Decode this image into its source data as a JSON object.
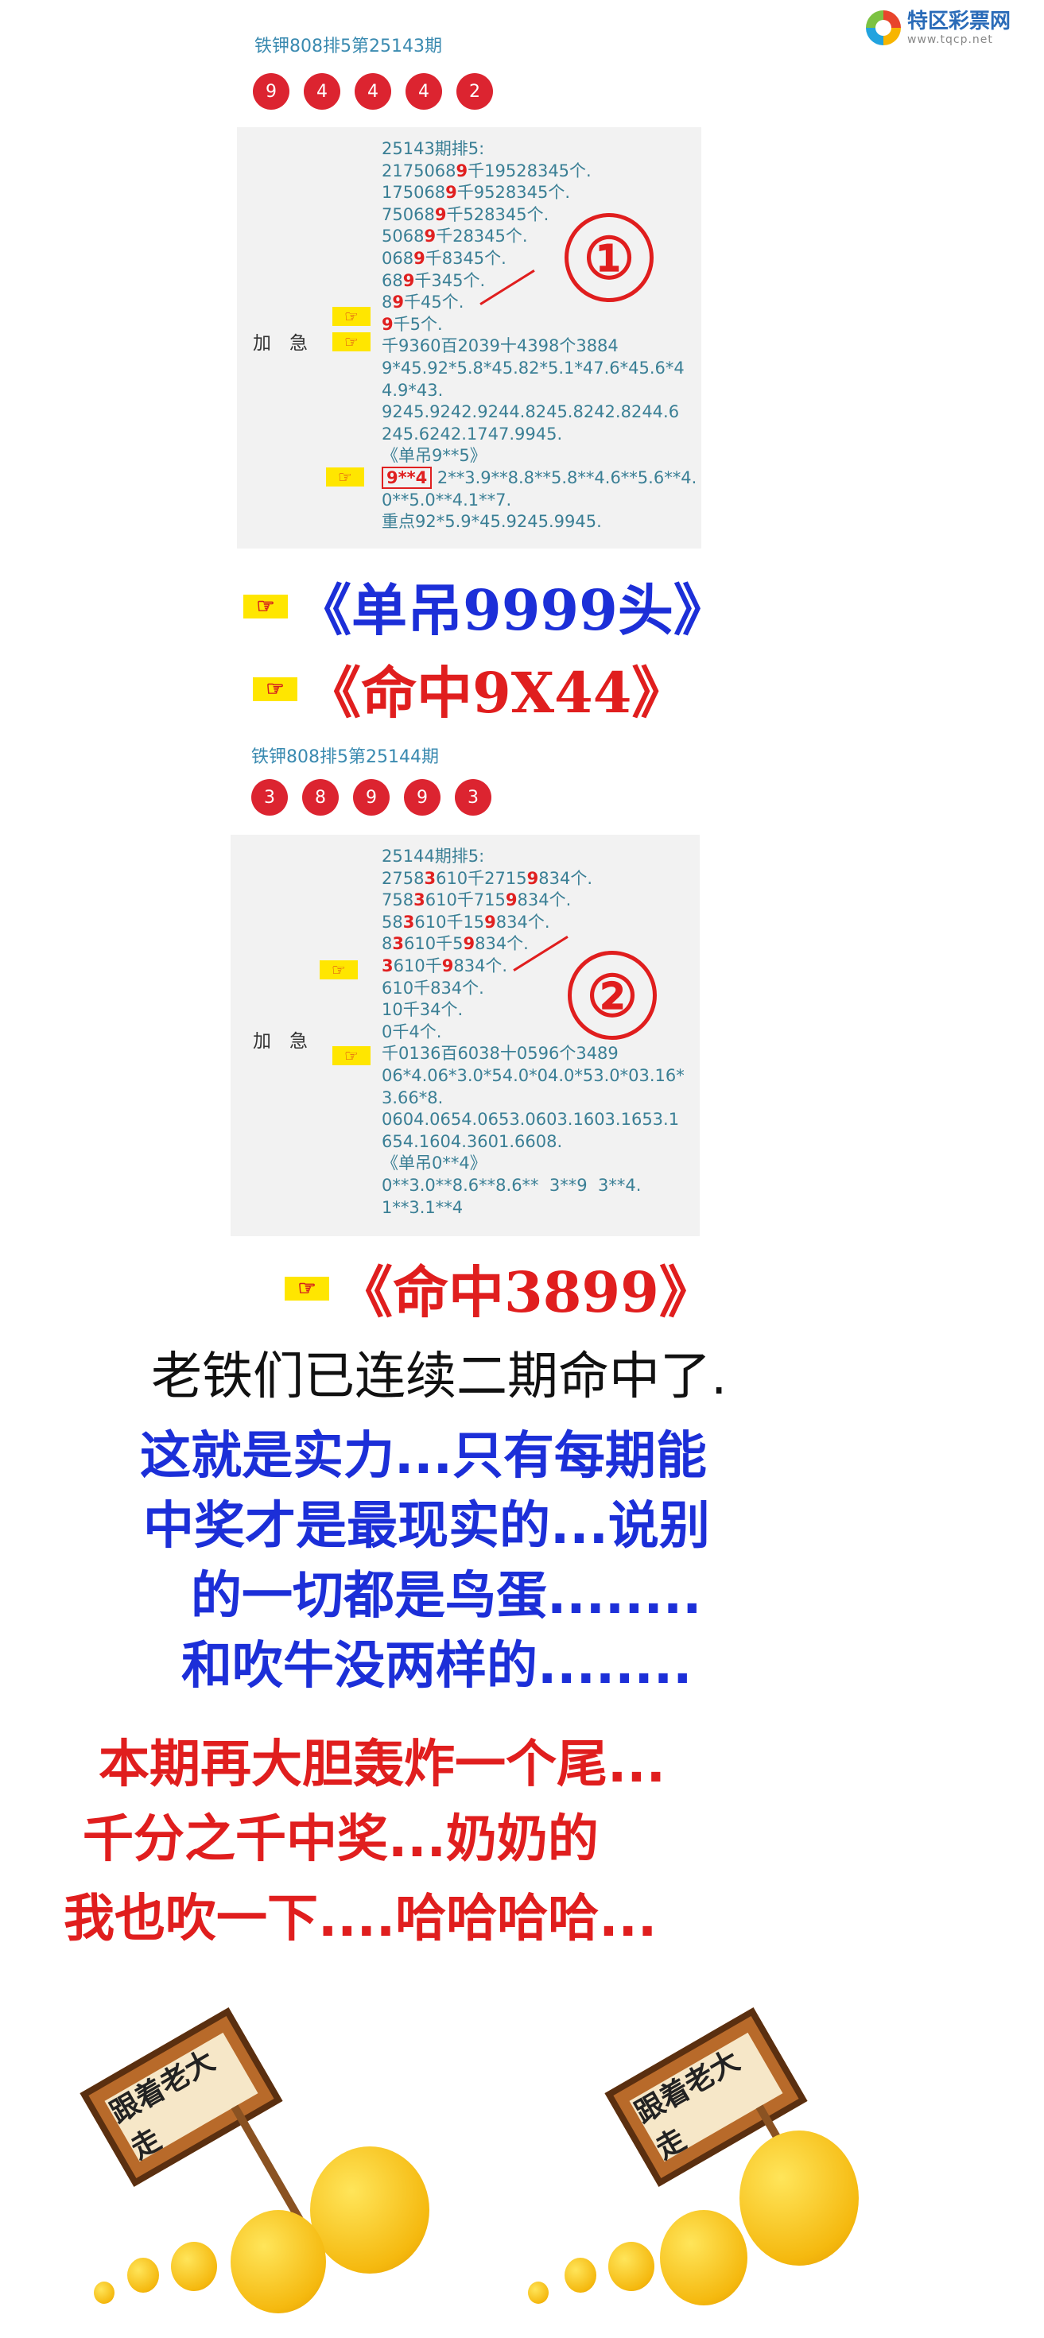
{
  "site": {
    "name": "特区彩票网",
    "url": "www.tqcp.net"
  },
  "section1": {
    "issue_title": "铁钾808排5第25143期",
    "balls": [
      "9",
      "4",
      "4",
      "4",
      "2"
    ],
    "badge": "①",
    "side_label": "加　急",
    "hand_icon": "pointing-hand-icon",
    "lines": [
      "25143期排5:",
      "2175068##9##千19528345个.",
      "175068##9##千9528345个.",
      "75068##9##千528345个.",
      "5068##9##千28345个.",
      "068##9##千8345个.",
      "68##9##千345个.",
      "8##9##千45个.",
      "##9##千5个.",
      "千9360百2039十4398个3884",
      "9*45.92*5.8*45.82*5.1*47.6*45.6*4",
      "4.9*43.",
      "9245.9242.9244.8245.8242.8244.6",
      "245.6242.1747.9945.",
      "《单吊9**5》",
      "9**4 2**3.9**8.8**5.8**4.6**5.6**4.",
      "0**5.0**4.1**7.",
      "重点92*5.9*45.9245.9945."
    ],
    "boxed_value": "9**4",
    "headline1": "《单吊9999头》",
    "headline2": "《命中9X44》"
  },
  "section2": {
    "issue_title": "铁钾808排5第25144期",
    "balls": [
      "3",
      "8",
      "9",
      "9",
      "3"
    ],
    "badge": "②",
    "side_label": "加　急",
    "lines": [
      "25144期排5:",
      "2758##3##610千2715##9##834个.",
      "758##3##610千715##9##834个.",
      "58##3##610千15##9##834个.",
      "8##3##610千5##9##834个.",
      "##3##610千##9##834个.",
      "610千834个.",
      "10千34个.",
      "0千4个.",
      "千0136百6038十0596个3489",
      "06*4.06*3.0*54.0*04.0*53.0*03.16*",
      "3.66*8.",
      "0604.0654.0653.0603.1603.1653.1",
      "654.1604.3601.6608.",
      "《单吊0**4》",
      "0**3.0**8.6**8.6**  3**9  3**4.",
      "1**3.1**4"
    ],
    "boxed_value": "3**9",
    "headline": "《命中3899》"
  },
  "texts": {
    "line_black": "老铁们已连续二期命中了.",
    "blue": [
      "这就是实力...只有每期能",
      "中奖才是最现实的...说别",
      "的一切都是鸟蛋........",
      "和吹牛没两样的........"
    ],
    "red": [
      "本期再大胆轰炸一个尾...",
      "千分之千中奖...奶奶的",
      "我也吹一下....哈哈哈哈..."
    ]
  },
  "sign_text": "跟着老大走",
  "colors": {
    "ball_red": "#dc2430",
    "headline_blue": "#1c2fd8",
    "headline_red": "#e01e1e",
    "panel_text": "#3a7f95"
  }
}
